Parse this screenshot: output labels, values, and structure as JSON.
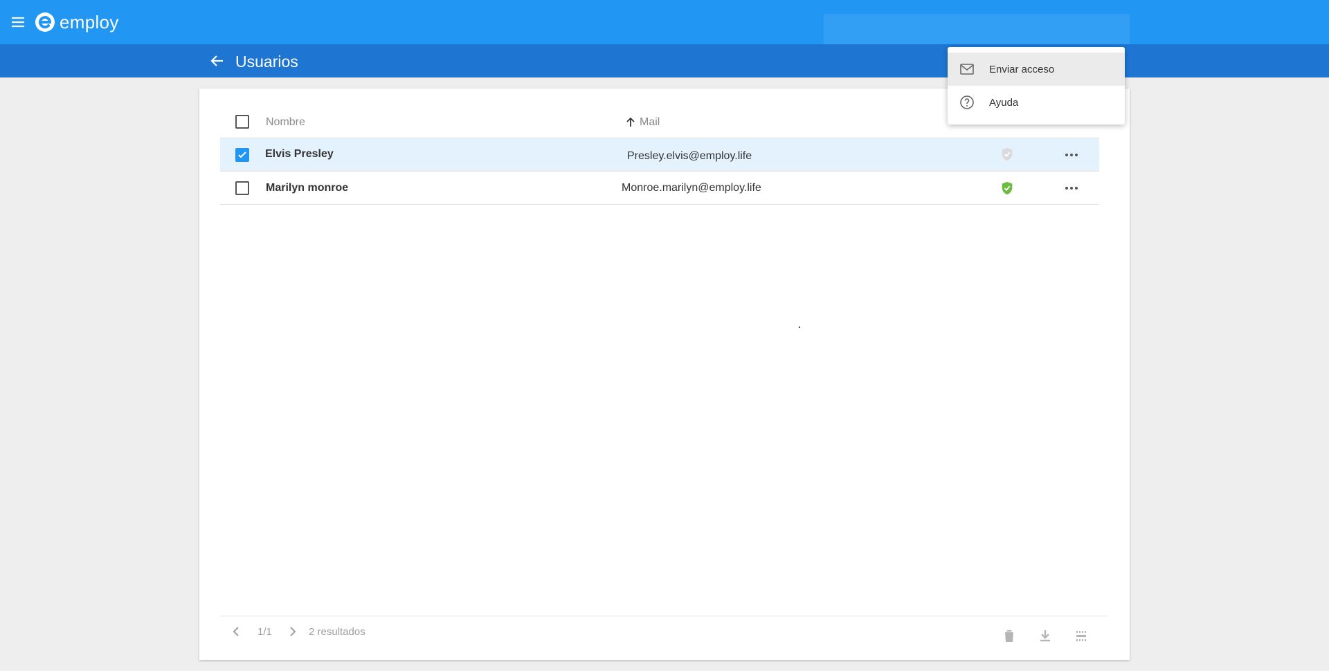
{
  "app": {
    "brand": "employ",
    "page_title": "Usuarios"
  },
  "table": {
    "columns": {
      "name": "Nombre",
      "mail": "Mail"
    },
    "rows": [
      {
        "name": "Elvis Presley",
        "mail": "Presley.elvis@employ.life",
        "selected": true,
        "access_status": "inactive",
        "shield_color": "#dadada"
      },
      {
        "name": "Marilyn monroe",
        "mail": "Monroe.marilyn@employ.life",
        "selected": false,
        "access_status": "active",
        "shield_color": "#6cbb3c"
      }
    ]
  },
  "pagination": {
    "page": "1/1",
    "results": "2 resultados"
  },
  "popup_menu": {
    "items": [
      {
        "label": "Enviar acceso",
        "icon": "mail-icon"
      },
      {
        "label": "Ayuda",
        "icon": "help-circle-icon"
      }
    ]
  },
  "footer_actions": [
    "delete-icon",
    "download-icon",
    "column-settings-icon"
  ],
  "colors": {
    "primary": "#2196f3",
    "primary_dark": "#1e76d2",
    "selected_row": "#e3f2fd"
  }
}
